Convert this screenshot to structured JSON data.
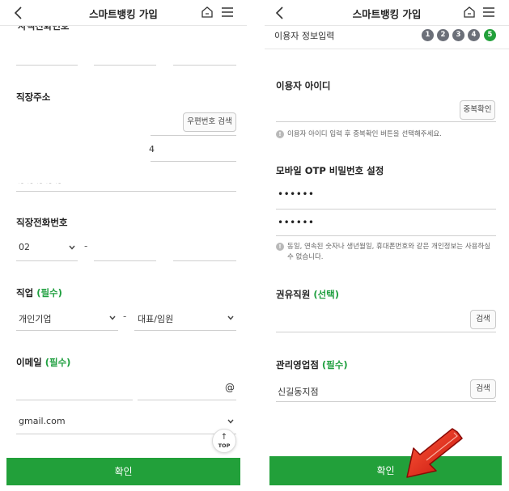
{
  "left": {
    "header": {
      "title": "스마트뱅킹 가입"
    },
    "partial_label": "자택전화번호",
    "work_address": {
      "label": "직장주소",
      "postal_search_label": "우편번호 검색",
      "address_value": "4"
    },
    "work_phone": {
      "label": "직장전화번호",
      "area_code": "02",
      "dash": "-"
    },
    "job": {
      "label": "직업",
      "required": "(필수)",
      "type_value": "개인기업",
      "dash": "-",
      "position_value": "대표/임원"
    },
    "email": {
      "label": "이메일",
      "required": "(필수)",
      "at_symbol": "@",
      "domain_value": "gmail.com"
    },
    "top_button": {
      "arrow": "↑",
      "label": "TOP"
    },
    "confirm_label": "확인"
  },
  "right": {
    "header": {
      "title": "스마트뱅킹 가입"
    },
    "section_title": "이용자 정보입력",
    "steps": [
      "1",
      "2",
      "3",
      "4",
      "5"
    ],
    "user_id": {
      "label": "이용자 아이디",
      "check_button": "중복확인",
      "help": "이용자 아이디 입력 후 중복확인 버튼을 선택해주세요."
    },
    "otp": {
      "label": "모바일 OTP 비밀번호 설정",
      "password_mask": "••••••",
      "confirm_mask": "••••••",
      "help": "동일, 연속된 숫자나 생년월일, 휴대폰번호와 같은 개인정보는 사용하실 수 없습니다."
    },
    "solicitor": {
      "label": "권유직원",
      "optional": "(선택)",
      "search_button": "검색"
    },
    "branch": {
      "label": "관리영업점",
      "required": "(필수)",
      "value": "신길동지점",
      "search_button": "검색"
    },
    "confirm_label": "확인"
  },
  "colors": {
    "accent": "#22a03a",
    "step_inactive": "#6b6f78",
    "annotation_arrow": "#e8231a"
  }
}
